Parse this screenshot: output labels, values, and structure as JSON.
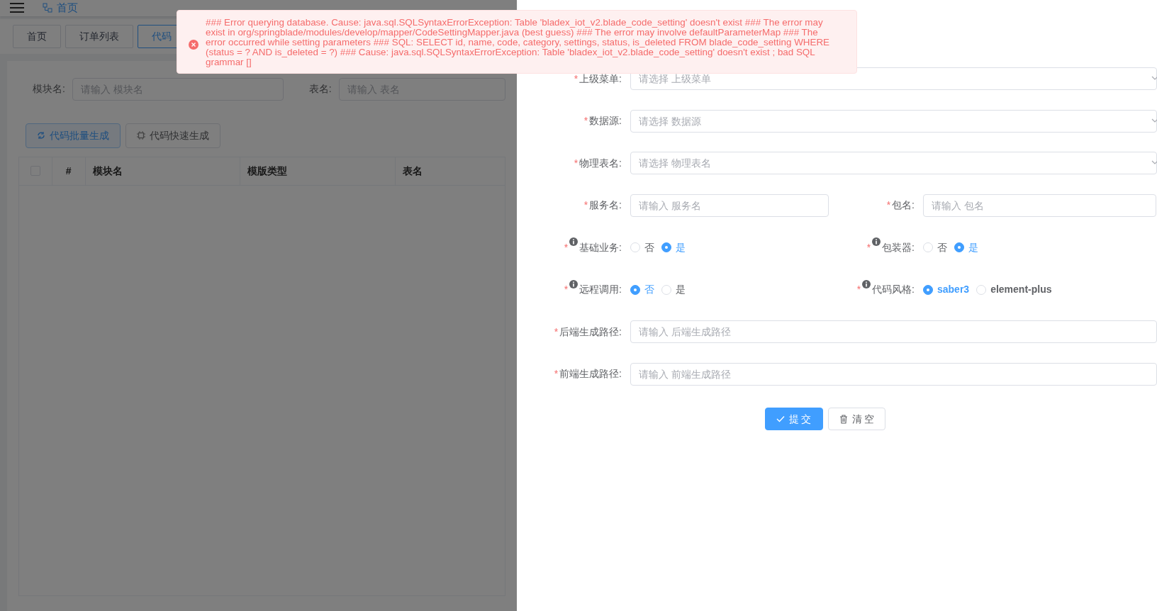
{
  "header": {
    "breadcrumb": "首页"
  },
  "tabs": [
    {
      "label": "首页",
      "selected": false
    },
    {
      "label": "订单列表",
      "selected": false
    },
    {
      "label": "代码",
      "selected": true
    }
  ],
  "search": [
    {
      "label": "模块名:",
      "placeholder": "请输入 模块名"
    },
    {
      "label": "表名:",
      "placeholder": "请输入 表名"
    }
  ],
  "actions": [
    {
      "label": "代码批量生成",
      "kind": "primary"
    },
    {
      "label": "代码快速生成",
      "kind": "plain"
    }
  ],
  "table": {
    "select_all": {
      "checked": false
    },
    "columns": [
      "#",
      "模块名",
      "模版类型",
      "表名"
    ]
  },
  "toast": {
    "message": "### Error querying database. Cause: java.sql.SQLSyntaxErrorException: Table 'bladex_iot_v2.blade_code_setting' doesn't exist ### The error may exist in org/springblade/modules/develop/mapper/CodeSettingMapper.java (best guess) ### The error may involve defaultParameterMap ### The error occurred while setting parameters ### SQL: SELECT id, name, code, category, settings, status, is_deleted FROM blade_code_setting WHERE (status = ? AND is_deleted = ?) ### Cause: java.sql.SQLSyntaxErrorException: Table 'bladex_iot_v2.blade_code_setting' doesn't exist ; bad SQL grammar []"
  },
  "form": {
    "rows": [
      [
        {
          "kind": "select",
          "required_mark": "*",
          "label": "上级菜单:",
          "placeholder": "请选择 上级菜单"
        }
      ],
      [
        {
          "kind": "select",
          "required_mark": "*",
          "label": "数据源:",
          "placeholder": "请选择 数据源"
        }
      ],
      [
        {
          "kind": "select",
          "required_mark": "*",
          "label": "物理表名:",
          "placeholder": "请选择 物理表名"
        }
      ],
      [
        {
          "kind": "input",
          "required_mark": "*",
          "label": "服务名:",
          "placeholder": "请输入 服务名"
        },
        {
          "kind": "input",
          "required_mark": "*",
          "label": "包名:",
          "placeholder": "请输入 包名"
        }
      ],
      [
        {
          "kind": "radio",
          "required_mark": "*",
          "label": "基础业务:",
          "options": [
            {
              "label": "否",
              "selected": false
            },
            {
              "label": "是",
              "selected": true
            }
          ]
        },
        {
          "kind": "radio",
          "required_mark": "*",
          "label": "包装器:",
          "options": [
            {
              "label": "否",
              "selected": false
            },
            {
              "label": "是",
              "selected": true
            }
          ]
        }
      ],
      [
        {
          "kind": "radio",
          "required_mark": "*",
          "label": "远程调用:",
          "options": [
            {
              "label": "否",
              "selected": true
            },
            {
              "label": "是",
              "selected": false
            }
          ]
        },
        {
          "kind": "radio",
          "required_mark": "*",
          "label": "代码风格:",
          "options": [
            {
              "label": "saber3",
              "selected": true
            },
            {
              "label": "element-plus",
              "selected": false
            }
          ]
        }
      ],
      [
        {
          "kind": "input",
          "required_mark": "*",
          "label": "后端生成路径:",
          "placeholder": "请输入 后端生成路径"
        }
      ],
      [
        {
          "kind": "input",
          "required_mark": "*",
          "label": "前端生成路径:",
          "placeholder": "请输入 前端生成路径"
        }
      ]
    ],
    "buttons": [
      {
        "label": "提 交",
        "kind": "primary"
      },
      {
        "label": "清 空",
        "kind": "plain"
      }
    ]
  }
}
